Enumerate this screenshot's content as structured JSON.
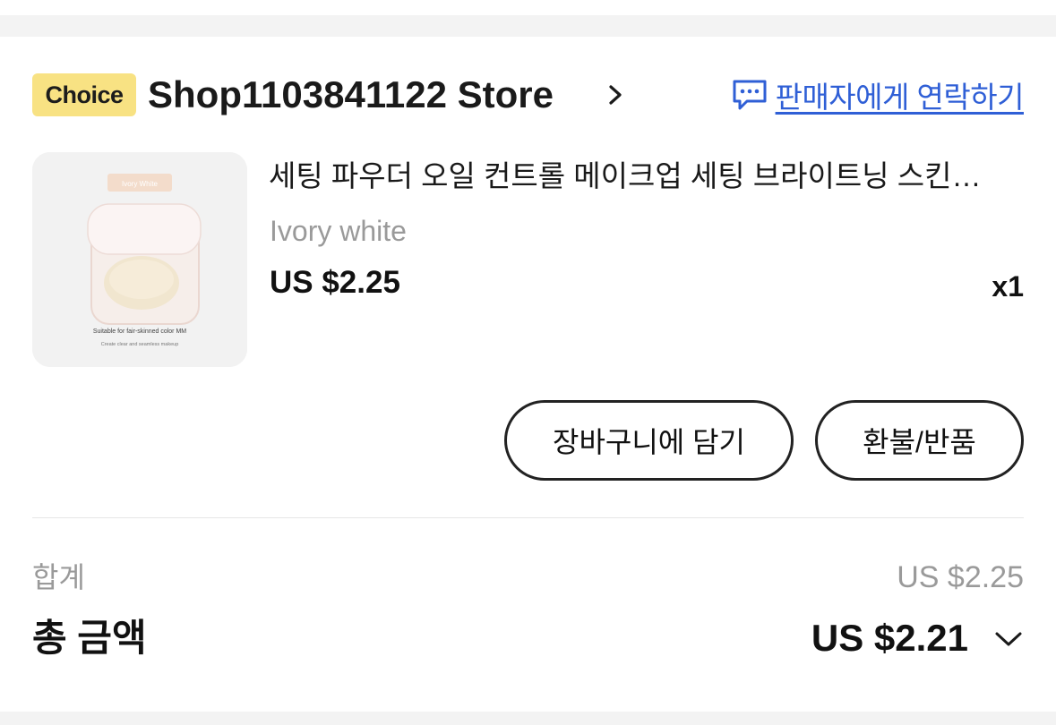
{
  "store": {
    "badge": "Choice",
    "name": "Shop1103841122 Store",
    "contact_label": "판매자에게 연락하기"
  },
  "product": {
    "title": "세팅 파우더 오일 컨트롤 메이크업 세팅 브라이트닝 스킨…",
    "variant": "Ivory white",
    "price": "US $2.25",
    "quantity": "x1",
    "image_label": "Ivory White",
    "image_caption": "Suitable for fair-skinned color MM",
    "image_subcaption": "Create clear and seamless makeup"
  },
  "actions": {
    "add_to_cart": "장바구니에 담기",
    "refund_return": "환불/반품"
  },
  "summary": {
    "subtotal_label": "합계",
    "subtotal_value": "US $2.25",
    "total_label": "총 금액",
    "total_value": "US $2.21"
  },
  "colors": {
    "badge_bg": "#f8e283",
    "link": "#2f5fd6",
    "muted_text": "#9a9a9a",
    "section_gap": "#f3f3f3"
  },
  "icons": {
    "contact": "chat-bubble-icon",
    "store_chevron": "chevron-right-icon",
    "total_chevron": "chevron-down-icon"
  }
}
